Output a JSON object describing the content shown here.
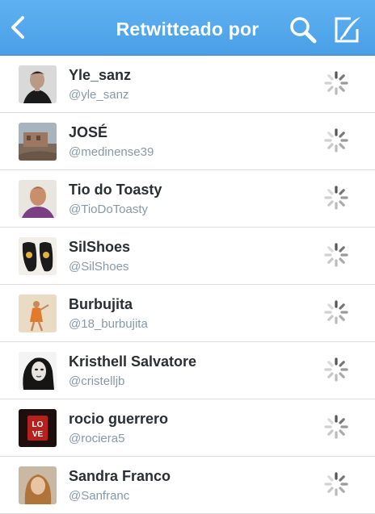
{
  "navbar": {
    "title": "Retwitteado por",
    "bg_color": "#55acee",
    "back_icon": "chevron-left-icon",
    "search_icon": "search-icon",
    "compose_icon": "compose-icon"
  },
  "users": [
    {
      "name": "Yle_sanz",
      "handle": "@yle_sanz",
      "avatar": "portrait-man-avatar"
    },
    {
      "name": "JOSÉ",
      "handle": "@medinense39",
      "avatar": "building-photo-avatar"
    },
    {
      "name": "Tio do Toasty",
      "handle": "@TioDoToasty",
      "avatar": "man-purple-shirt-avatar"
    },
    {
      "name": "SilShoes",
      "handle": "@SilShoes",
      "avatar": "shoes-photo-avatar"
    },
    {
      "name": "Burbujita",
      "handle": "@18_burbujita",
      "avatar": "girl-dancing-avatar"
    },
    {
      "name": "Kristhell Salvatore",
      "handle": "@cristelljb",
      "avatar": "woman-bw-portrait-avatar"
    },
    {
      "name": "rocio guerrero",
      "handle": "@rociera5",
      "avatar": "love-sign-avatar"
    },
    {
      "name": "Sandra Franco",
      "handle": "@Sanfranc",
      "avatar": "woman-blonde-avatar"
    }
  ],
  "row_status_icon": "loading-spinner-icon",
  "colors": {
    "name_text": "#292f33",
    "handle_text": "#8899a6",
    "divider": "#dcdcdc"
  }
}
